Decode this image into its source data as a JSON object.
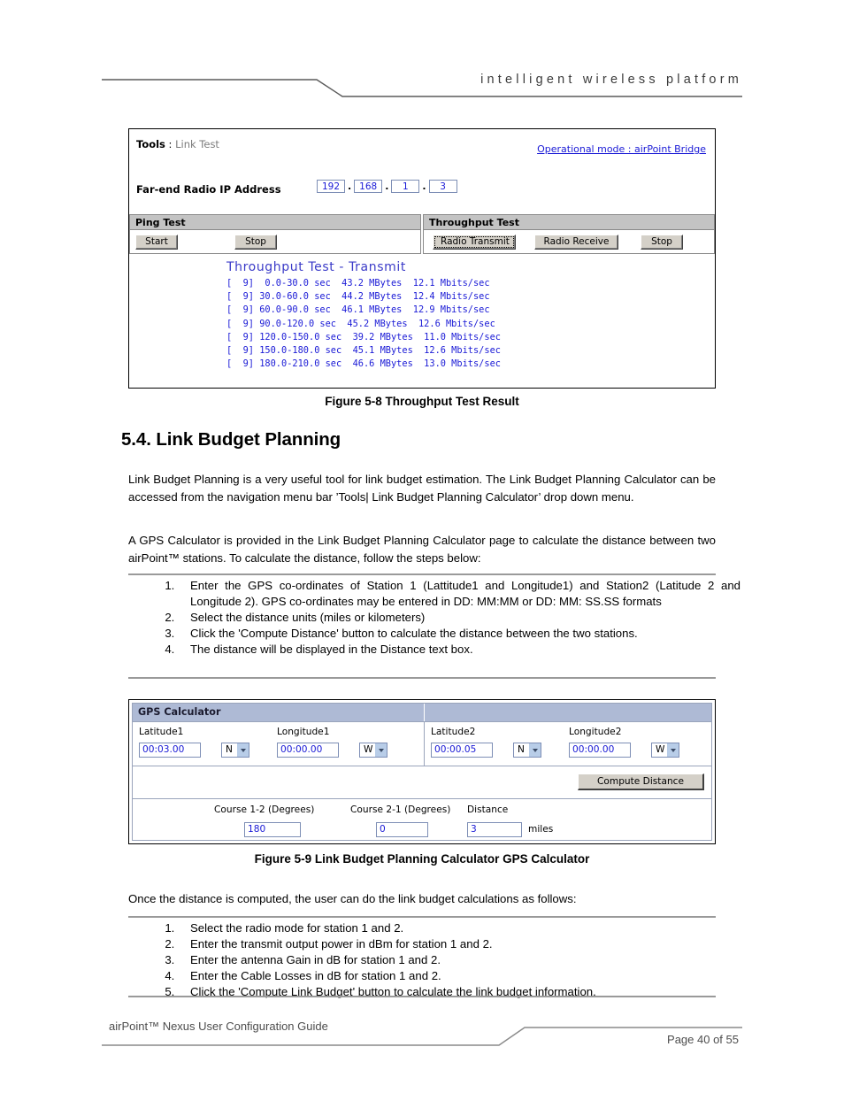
{
  "page_header": {
    "tagline": "intelligent   wireless   platform"
  },
  "figure_5_8": {
    "caption": "Figure 5-8 Throughput Test Result",
    "breadcrumb_root": "Tools",
    "breadcrumb_sep": " : ",
    "breadcrumb_page": "Link Test",
    "operational_mode_link": "Operational mode : airPoint Bridge",
    "farend_label": "Far-end Radio IP Address",
    "ip_octets": [
      "192",
      "168",
      "1",
      "3"
    ],
    "ip_separator": ".",
    "ping_panel": {
      "title": "Ping Test",
      "start_label": "Start",
      "stop_label": "Stop"
    },
    "throughput_panel": {
      "title": "Throughput Test",
      "radio_transmit_label": "Radio Transmit",
      "radio_receive_label": "Radio Receive",
      "stop_label": "Stop"
    },
    "result": {
      "title": "Throughput Test - Transmit",
      "lines": [
        "[  9]  0.0-30.0 sec  43.2 MBytes  12.1 Mbits/sec",
        "[  9] 30.0-60.0 sec  44.2 MBytes  12.4 Mbits/sec",
        "[  9] 60.0-90.0 sec  46.1 MBytes  12.9 Mbits/sec",
        "[  9] 90.0-120.0 sec  45.2 MBytes  12.6 Mbits/sec",
        "[  9] 120.0-150.0 sec  39.2 MBytes  11.0 Mbits/sec",
        "[  9] 150.0-180.0 sec  45.1 MBytes  12.6 Mbits/sec",
        "[  9] 180.0-210.0 sec  46.6 MBytes  13.0 Mbits/sec"
      ]
    }
  },
  "section": {
    "heading": "5.4. Link Budget Planning",
    "para1": "Link Budget Planning is a very useful tool for link budget estimation.   The Link Budget Planning Calculator can be accessed from the navigation menu bar ’Tools| Link Budget Planning Calculator’ drop down menu.",
    "para2": "A GPS Calculator is provided in the Link Budget Planning Calculator page to calculate the distance between two airPoint™ stations.   To calculate the distance, follow the steps below:",
    "steps1": [
      "Enter the GPS co-ordinates of Station 1 (Lattitude1 and Longitude1) and Station2 (Latitude 2 and Longitude 2). GPS co-ordinates may be entered in DD: MM:MM or DD: MM: SS.SS formats",
      "Select the distance units (miles or kilometers)",
      "Click the 'Compute Distance' button to calculate the distance between the two stations.",
      "The distance will be displayed in the Distance text box."
    ],
    "para3": "Once the distance is computed, the user can do the link budget calculations as follows:",
    "steps2": [
      "Select the radio mode for station 1 and 2.",
      "Enter the transmit output power in dBm for station 1 and 2.",
      "Enter the antenna Gain in dB for station 1 and 2.",
      "Enter the Cable Losses in dB for station 1 and 2.",
      "Click the 'Compute Link Budget' button to calculate the link budget information."
    ]
  },
  "figure_5_9": {
    "caption": "Figure 5-9 Link Budget Planning Calculator GPS Calculator",
    "panel_title": "GPS Calculator",
    "fields": {
      "latitude1_label": "Latitude1",
      "latitude1_value": "00:03.00",
      "latitude1_hemisphere": "N",
      "longitude1_label": "Longitude1",
      "longitude1_value": "00:00.00",
      "longitude1_hemisphere": "W",
      "latitude2_label": "Latitude2",
      "latitude2_value": "00:00.05",
      "latitude2_hemisphere": "N",
      "longitude2_label": "Longitude2",
      "longitude2_value": "00:00.00",
      "longitude2_hemisphere": "W"
    },
    "compute_button_label": "Compute Distance",
    "results": {
      "course_12_label": "Course 1-2 (Degrees)",
      "course_12_value": "180",
      "course_21_label": "Course 2-1 (Degrees)",
      "course_21_value": "0",
      "distance_label": "Distance",
      "distance_value": "3",
      "distance_unit": "miles"
    }
  },
  "page_footer": {
    "doc_title": "airPoint™ Nexus User Configuration Guide",
    "page_number": "Page 40 of 55"
  },
  "colors": {
    "link_blue": "#1a1ad6",
    "result_text_blue": "#1a1ad6",
    "result_title_blue": "#3b3bc8",
    "panel_gray": "#c3c3c3",
    "gps_header_blue": "#aebad5",
    "button_face": "#d4d0c8"
  }
}
